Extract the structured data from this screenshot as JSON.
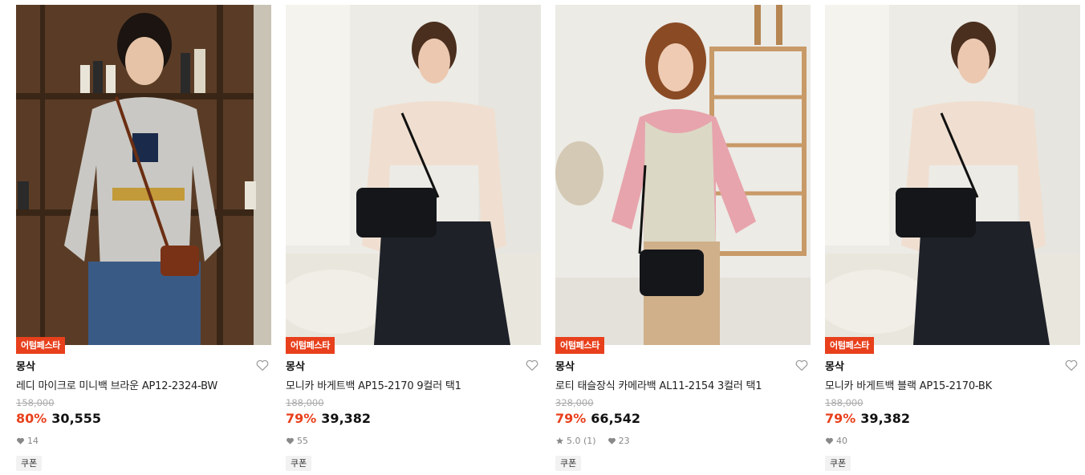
{
  "products": [
    {
      "badge": "어텀페스타",
      "brand": "몽삭",
      "name": "레디 마이크로 미니백 브라운 AP12-2324-BW",
      "original_price": "158,000",
      "discount": "80%",
      "price": "30,555",
      "rating": "",
      "likes": "14",
      "coupon": "쿠폰",
      "image_icon": "product-photo"
    },
    {
      "badge": "어텀페스타",
      "brand": "몽삭",
      "name": "모니카 바게트백 AP15-2170 9컬러 택1",
      "original_price": "188,000",
      "discount": "79%",
      "price": "39,382",
      "rating": "",
      "likes": "55",
      "coupon": "쿠폰",
      "image_icon": "product-photo"
    },
    {
      "badge": "어텀페스타",
      "brand": "몽삭",
      "name": "로티 태슬장식 카메라백 AL11-2154 3컬러 택1",
      "original_price": "328,000",
      "discount": "79%",
      "price": "66,542",
      "rating": "5.0 (1)",
      "likes": "23",
      "coupon": "쿠폰",
      "image_icon": "product-photo"
    },
    {
      "badge": "어텀페스타",
      "brand": "몽삭",
      "name": "모니카 바게트백 블랙 AP15-2170-BK",
      "original_price": "188,000",
      "discount": "79%",
      "price": "39,382",
      "rating": "",
      "likes": "40",
      "coupon": "쿠폰",
      "image_icon": "product-photo"
    }
  ],
  "colors": {
    "accent": "#e8401c",
    "text": "#111111",
    "muted": "#888888"
  }
}
